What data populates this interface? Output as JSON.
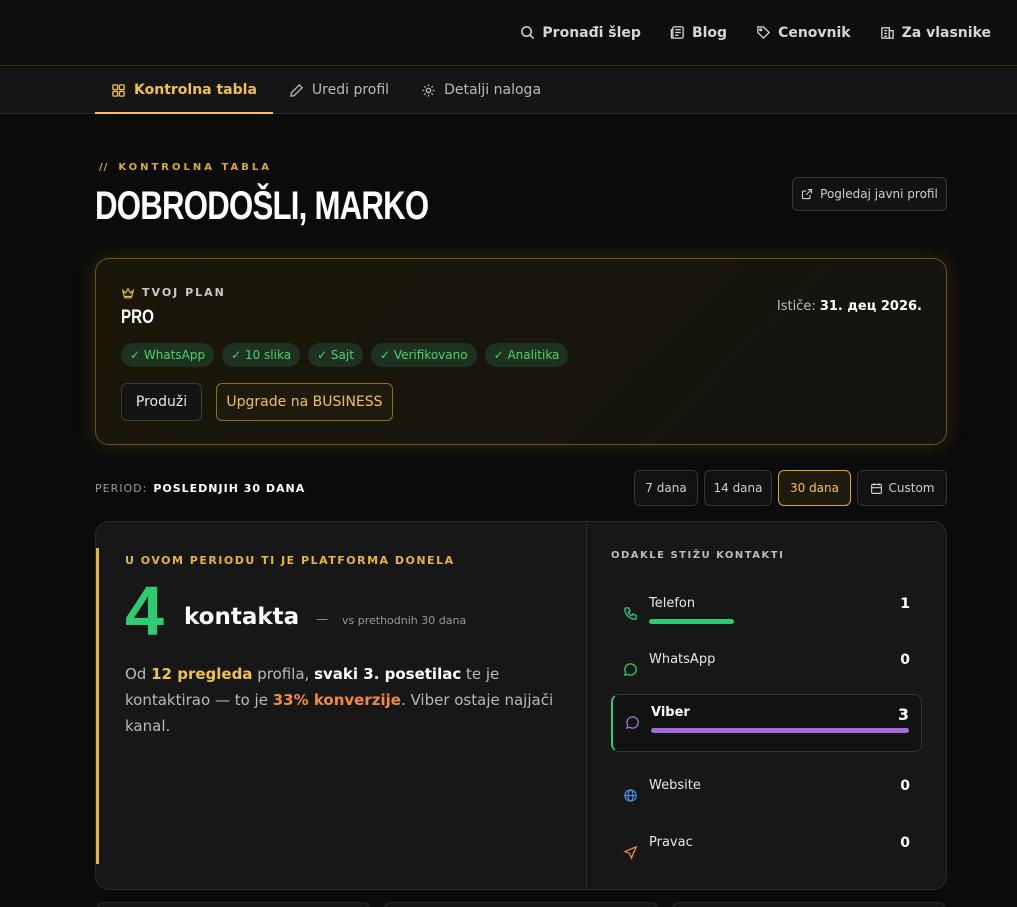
{
  "topnav": {
    "items": [
      {
        "label": "Pronađi šlep",
        "icon": "search-icon"
      },
      {
        "label": "Blog",
        "icon": "newspaper-icon"
      },
      {
        "label": "Cenovnik",
        "icon": "tag-icon"
      },
      {
        "label": "Za vlasnike",
        "icon": "building-icon"
      }
    ]
  },
  "tabs": [
    {
      "label": "Kontrolna tabla",
      "icon": "dashboard-icon",
      "active": true
    },
    {
      "label": "Uredi profil",
      "icon": "pencil-icon",
      "active": false
    },
    {
      "label": "Detalji naloga",
      "icon": "gear-icon",
      "active": false
    }
  ],
  "header": {
    "eyebrow_slashes": "//",
    "eyebrow": "KONTROLNA TABLA",
    "title": "DOBRODOŠLI, MARKO",
    "public_profile_label": "Pogledaj javni profil"
  },
  "plan": {
    "label": "TVOJ PLAN",
    "name": "PRO",
    "expiry_label": "Ističe:",
    "expiry_date": "31. дец 2026.",
    "features": [
      "✓ WhatsApp",
      "✓ 10 slika",
      "✓ Sajt",
      "✓ Verifikovano",
      "✓ Analitika"
    ],
    "extend_label": "Produži",
    "upgrade_label": "Upgrade na BUSINESS"
  },
  "period": {
    "label": "PERIOD:",
    "value": "POSLEDNJIH 30 DANA",
    "options": [
      "7 dana",
      "14 dana",
      "30 dana",
      "Custom"
    ],
    "selected": "30 dana"
  },
  "summary": {
    "eyebrow": "U OVOM PERIODU TI JE PLATFORMA DONELA",
    "count": "4",
    "unit": "kontakta",
    "dash": "—",
    "compare": "vs prethodnih 30 dana",
    "desc_1": "Od ",
    "views": "12 pregleda",
    "desc_2": " profila, ",
    "ratio": "svaki 3. posetilac",
    "desc_3": " te je kontaktirao — to je ",
    "conversion": "33% konverzije",
    "desc_4": ". Viber ostaje najjači kanal."
  },
  "sources": {
    "title": "ODAKLE STIŽU KONTAKTI",
    "items": [
      {
        "name": "Telefon",
        "value": "1",
        "share": 0.33,
        "color": "#2ecc71",
        "icon": "phone-icon",
        "icon_color": "#2ecc71"
      },
      {
        "name": "WhatsApp",
        "value": "0",
        "share": 0,
        "color": "#25d366",
        "icon": "whatsapp-icon",
        "icon_color": "#25d366"
      },
      {
        "name": "Viber",
        "value": "3",
        "share": 1.0,
        "color": "#a46cd8",
        "icon": "viber-icon",
        "icon_color": "#a46cd8",
        "highlight": true
      },
      {
        "name": "Website",
        "value": "0",
        "share": 0,
        "color": "#4a90e2",
        "icon": "globe-icon",
        "icon_color": "#4a90e2"
      },
      {
        "name": "Pravac",
        "value": "0",
        "share": 0,
        "color": "#f08a3c",
        "icon": "navigation-icon",
        "icon_color": "#f08a3c"
      }
    ]
  }
}
